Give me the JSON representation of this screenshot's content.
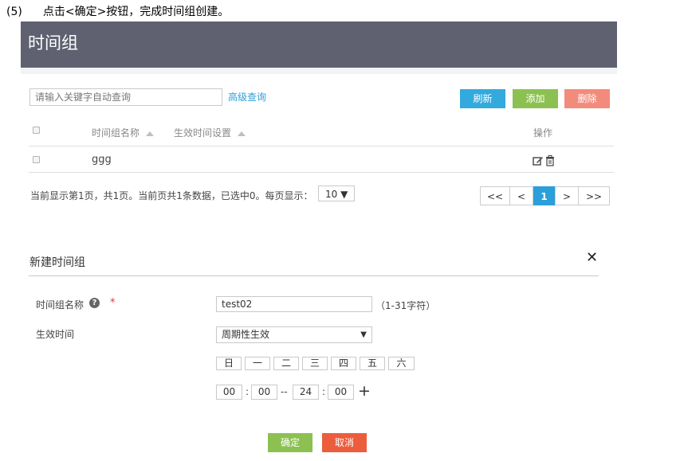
{
  "step": {
    "number": "(5)",
    "text": "点击<确定>按钮，完成时间组创建。"
  },
  "page_title": "时间组",
  "toolbar": {
    "search_placeholder": "请输入关键字自动查询",
    "advanced_search": "高级查询",
    "refresh": "刷新",
    "add": "添加",
    "delete": "删除"
  },
  "table": {
    "columns": [
      "时间组名称",
      "生效时间设置",
      "操作"
    ],
    "rows": [
      {
        "name": "ggg",
        "setting": ""
      }
    ]
  },
  "pagination": {
    "info": "当前显示第1页，共1页。当前页共1条数据，已选中0。每页显示：",
    "page_size": "10 ▼",
    "first": "<<",
    "prev": "<",
    "current": "1",
    "next": ">",
    "last": ">>"
  },
  "dialog": {
    "title": "新建时间组",
    "close": "✕",
    "name_label": "时间组名称",
    "help": "?",
    "required": "*",
    "name_value": "test02",
    "name_hint": "（1-31字符）",
    "effect_label": "生效时间",
    "effect_value": "周期性生效",
    "effect_arrow": "▼",
    "days": [
      "日",
      "一",
      "二",
      "三",
      "四",
      "五",
      "六"
    ],
    "time": {
      "start_h": "00",
      "colon": ":",
      "start_m": "00",
      "dash": "--",
      "end_h": "24",
      "end_m": "00",
      "add": "+"
    },
    "ok": "确定",
    "cancel": "取消"
  },
  "colors": {
    "header": "#5f6170",
    "blue": "#33aadd",
    "green": "#8cc152",
    "red": "#f38b7c",
    "cancel": "#ec5d3d"
  }
}
